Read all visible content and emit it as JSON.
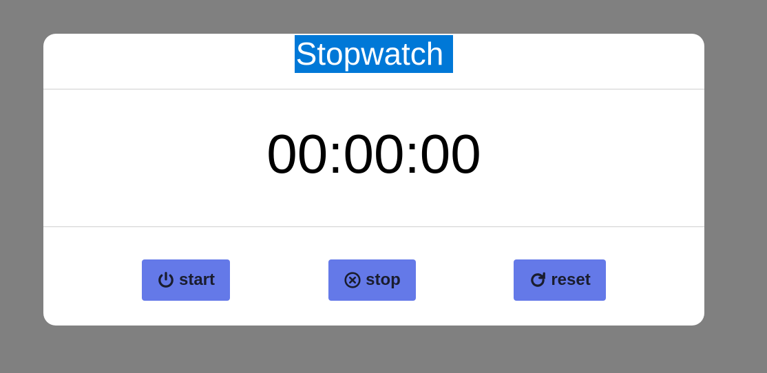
{
  "app": {
    "title": "Stopwatch"
  },
  "display": {
    "time": "00:00:00"
  },
  "controls": {
    "start_label": "start",
    "start_icon": "power-icon",
    "stop_label": "stop",
    "stop_icon": "circle-x-icon",
    "reset_label": "reset",
    "reset_icon": "rotate-cw-icon"
  },
  "colors": {
    "background": "#808080",
    "card": "#ffffff",
    "title_highlight": "#0078d7",
    "button": "#6479e8",
    "button_text": "#1a1d2e"
  }
}
